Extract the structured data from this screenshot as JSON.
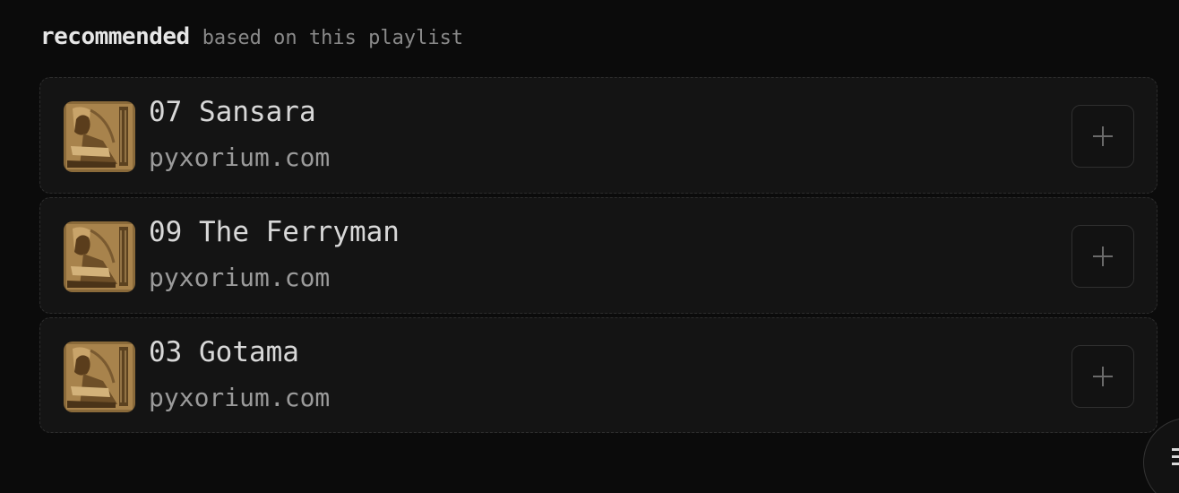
{
  "section": {
    "title": "recommended",
    "subtitle": "based on this playlist"
  },
  "tracks": [
    {
      "title": "07 Sansara",
      "source": "pyxorium.com",
      "art": "album-art-icon",
      "add": "add-icon"
    },
    {
      "title": "09 The Ferryman",
      "source": "pyxorium.com",
      "art": "album-art-icon",
      "add": "add-icon"
    },
    {
      "title": "03 Gotama",
      "source": "pyxorium.com",
      "art": "album-art-icon",
      "add": "add-icon"
    }
  ],
  "fab": {
    "icon": "menu-icon"
  },
  "colors": {
    "background": "#0b0b0b",
    "card": "#141414",
    "title": "#d8d8d8",
    "muted": "#9b9b9b",
    "art_gold": "#b08a4e"
  }
}
